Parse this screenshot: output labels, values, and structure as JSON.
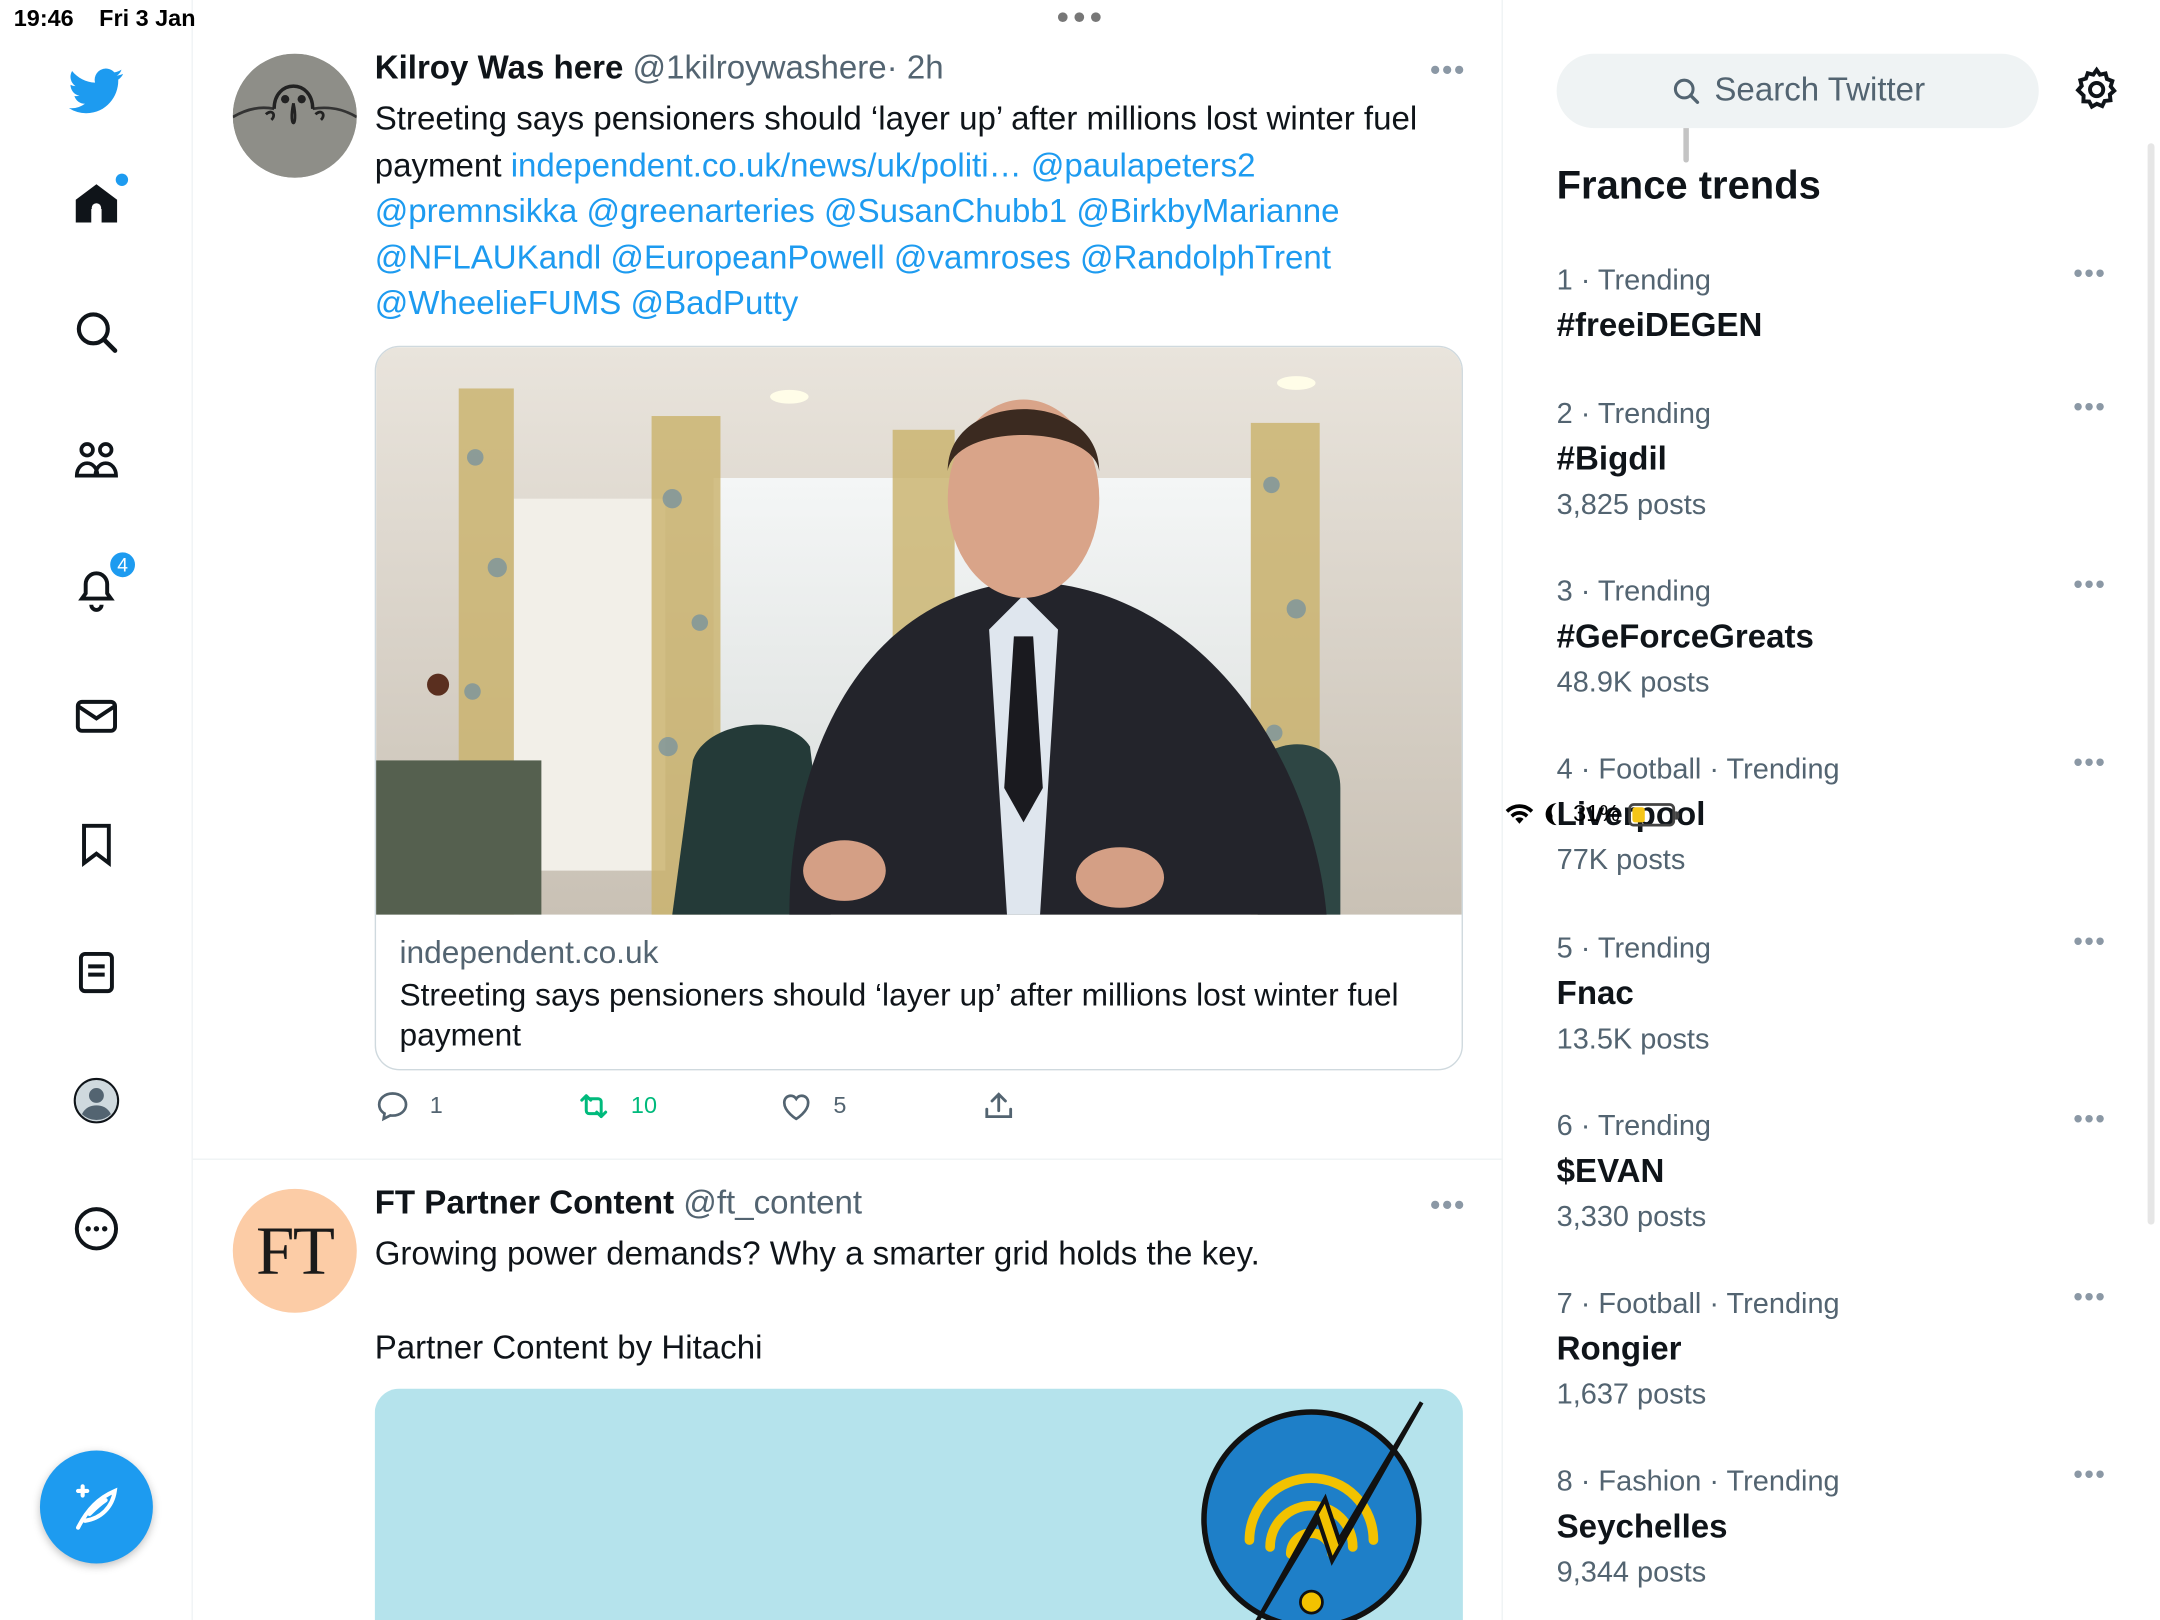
{
  "status_bar": {
    "time": "19:46",
    "date": "Fri 3 Jan",
    "battery": "31%",
    "battery_level": 0.31
  },
  "nav": {
    "items": [
      "home",
      "explore",
      "communities",
      "notifications",
      "messages",
      "bookmarks",
      "lists",
      "profile",
      "more"
    ],
    "notifications_badge": "4"
  },
  "tweets": [
    {
      "name": "Kilroy Was here",
      "handle": "@1kilroywashere",
      "time": "· 2h",
      "text": "Streeting says pensioners should ‘layer up’ after millions lost winter fuel payment",
      "link": "independent.co.uk/news/uk/politi…",
      "mentions_line1": "@paulapeters2",
      "mentions_line2": "@premnsikka  @greenarteries @SusanChubb1 @BirkbyMarianne",
      "mentions_line3": "@NFLAUKandl @EuropeanPowell @vamroses @RandolphTrent",
      "mentions_line4": "@WheelieFUMS @BadPutty",
      "card_domain": "independent.co.uk",
      "card_title": "Streeting says pensioners should ‘layer up’ after millions lost winter fuel payment",
      "replies": "1",
      "retweets": "10",
      "likes": "5"
    },
    {
      "name": "FT Partner Content",
      "handle": "@ft_content",
      "avatar_text": "FT",
      "text": "Growing power demands? Why a smarter grid holds the key.",
      "subtext": "Partner Content by Hitachi"
    }
  ],
  "search": {
    "placeholder": "Search Twitter"
  },
  "trends": {
    "title": "France trends",
    "items": [
      {
        "meta": "1 · Trending",
        "name": "#freeiDEGEN",
        "posts": ""
      },
      {
        "meta": "2 · Trending",
        "name": "#Bigdil",
        "posts": "3,825 posts"
      },
      {
        "meta": "3 · Trending",
        "name": "#GeForceGreats",
        "posts": "48.9K posts"
      },
      {
        "meta": "4 · Football · Trending",
        "name": "Liverpool",
        "posts": "77K posts"
      },
      {
        "meta": "5 · Trending",
        "name": "Fnac",
        "posts": "13.5K posts"
      },
      {
        "meta": "6 · Trending",
        "name": "$EVAN",
        "posts": "3,330 posts"
      },
      {
        "meta": "7 · Football · Trending",
        "name": "Rongier",
        "posts": "1,637 posts"
      },
      {
        "meta": "8 · Fashion · Trending",
        "name": "Seychelles",
        "posts": "9,344 posts"
      }
    ]
  },
  "colors": {
    "accent": "#1d9bf0",
    "retweet": "#00ba7c",
    "muted": "#536471",
    "ft_avatar": "#fccca6"
  }
}
